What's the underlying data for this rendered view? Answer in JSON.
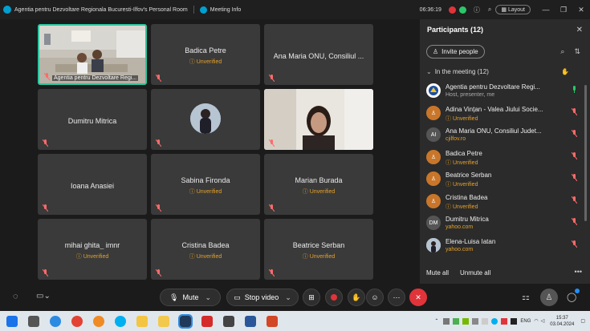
{
  "titlebar": {
    "title": "Agentia pentru Dezvoltare Regionala Bucuresti-Ilfov's Personal Room",
    "meeting_info": "Meeting Info",
    "time": "06:36:19",
    "layout": "Layout"
  },
  "tiles": [
    {
      "name": "",
      "caption": "Agentia pentru Dezvoltare Regi...",
      "unverified": ""
    },
    {
      "name": "Badica Petre",
      "unverified": "Unverified"
    },
    {
      "name": "Ana Maria ONU, Consiliul ...",
      "unverified": ""
    },
    {
      "name": "Dumitru Mitrica",
      "unverified": ""
    },
    {
      "name": "",
      "unverified": ""
    },
    {
      "name": "",
      "unverified": ""
    },
    {
      "name": "Ioana Anasiei",
      "unverified": ""
    },
    {
      "name": "Sabina Fironda",
      "unverified": "Unverified"
    },
    {
      "name": "Marian Burada",
      "unverified": "Unverified"
    },
    {
      "name": "mihai ghita_ imnr",
      "unverified": "Unverified"
    },
    {
      "name": "Cristina Badea",
      "unverified": "Unverified"
    },
    {
      "name": "Beatrice Serban",
      "unverified": "Unverified"
    }
  ],
  "panel": {
    "title": "Participants (12)",
    "invite": "Invite people",
    "section": "In the meeting (12)",
    "participants": [
      {
        "name": "Agentia pentru Dezvoltare Regi...",
        "sub": "Host, presenter, me",
        "initials": "",
        "color": "#ffffff",
        "subcolor": "gray"
      },
      {
        "name": "Adina Vințan - Valea Jiului Socie...",
        "sub": "Unverified",
        "initials": "",
        "color": "#c9762a",
        "subcolor": "orange"
      },
      {
        "name": "Ana Maria ONU, Consiliul Judet...",
        "sub": "cjilfov.ro",
        "initials": "AI",
        "color": "#555555",
        "subcolor": "orange"
      },
      {
        "name": "Badica Petre",
        "sub": "Unverified",
        "initials": "",
        "color": "#c9762a",
        "subcolor": "orange"
      },
      {
        "name": "Beatrice Serban",
        "sub": "Unverified",
        "initials": "",
        "color": "#c9762a",
        "subcolor": "orange"
      },
      {
        "name": "Cristina Badea",
        "sub": "Unverified",
        "initials": "",
        "color": "#c9762a",
        "subcolor": "orange"
      },
      {
        "name": "Dumitru Mitrica",
        "sub": "yahoo.com",
        "initials": "DM",
        "color": "#555555",
        "subcolor": "orange"
      },
      {
        "name": "Elena-Luisa Iatan",
        "sub": "yahoo.com",
        "initials": "",
        "color": "#8a9bb0",
        "subcolor": "orange"
      }
    ],
    "mute_all": "Mute all",
    "unmute_all": "Unmute all"
  },
  "controls": {
    "mute": "Mute",
    "stop_video": "Stop video"
  },
  "taskbar": {
    "lang": "ENG",
    "time": "15:37",
    "date": "03.04.2024"
  }
}
